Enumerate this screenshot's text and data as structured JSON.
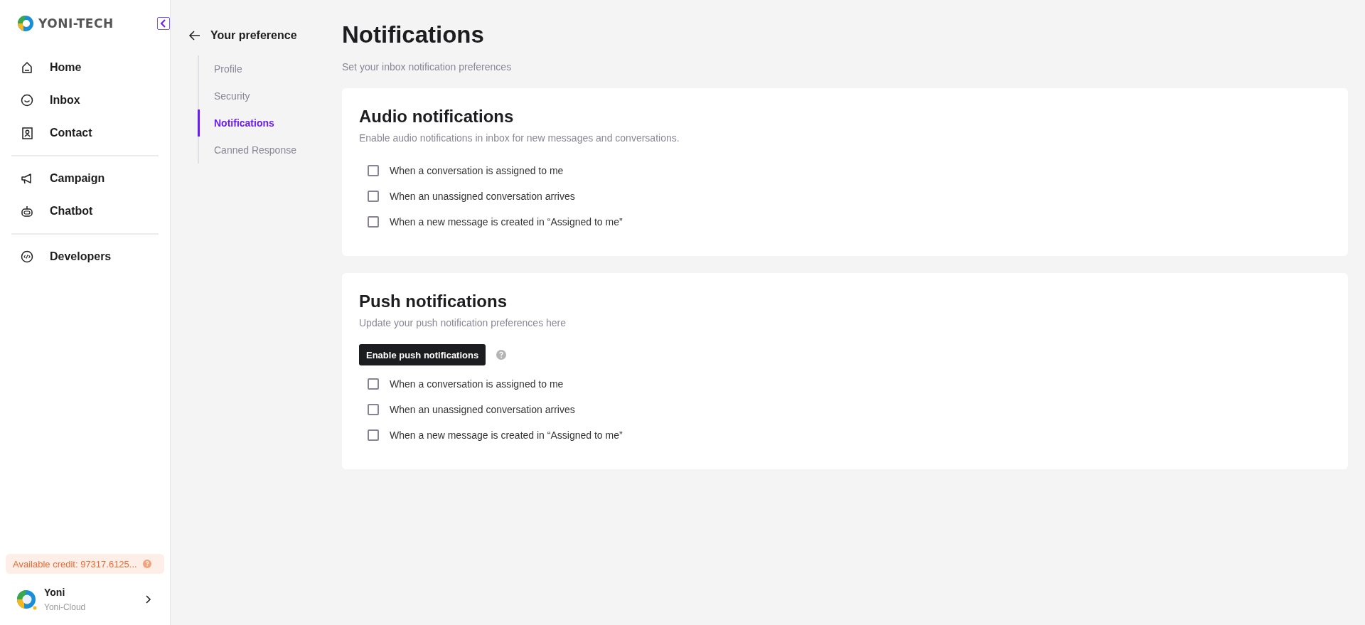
{
  "brand": {
    "name": "YONI-TECH"
  },
  "nav_groups": [
    {
      "items": [
        {
          "label": "Home"
        },
        {
          "label": "Inbox"
        },
        {
          "label": "Contact"
        }
      ]
    },
    {
      "items": [
        {
          "label": "Campaign"
        },
        {
          "label": "Chatbot"
        }
      ]
    },
    {
      "items": [
        {
          "label": "Developers"
        }
      ]
    }
  ],
  "credit": {
    "text": "Available credit: 97317.6125..."
  },
  "user": {
    "name": "Yoni",
    "org": "Yoni-Cloud"
  },
  "submenu": {
    "title": "Your preference",
    "items": [
      {
        "label": "Profile",
        "selected": false
      },
      {
        "label": "Security",
        "selected": false
      },
      {
        "label": "Notifications",
        "selected": true
      },
      {
        "label": "Canned Response",
        "selected": false
      }
    ]
  },
  "page": {
    "title": "Notifications",
    "subtitle": "Set your inbox notification preferences"
  },
  "sections": [
    {
      "title": "Audio notifications",
      "description": "Enable audio notifications in inbox for new messages and conversations.",
      "options": [
        {
          "label": "When a conversation is assigned to me",
          "checked": false
        },
        {
          "label": "When an unassigned conversation arrives",
          "checked": false
        },
        {
          "label": "When a new message is created in “Assigned to me”",
          "checked": false
        }
      ]
    },
    {
      "title": "Push notifications",
      "description": "Update your push notification preferences here",
      "button": "Enable push notifications",
      "options": [
        {
          "label": "When a conversation is assigned to me",
          "checked": false
        },
        {
          "label": "When an unassigned conversation arrives",
          "checked": false
        },
        {
          "label": "When a new message is created in “Assigned to me”",
          "checked": false
        }
      ]
    }
  ]
}
